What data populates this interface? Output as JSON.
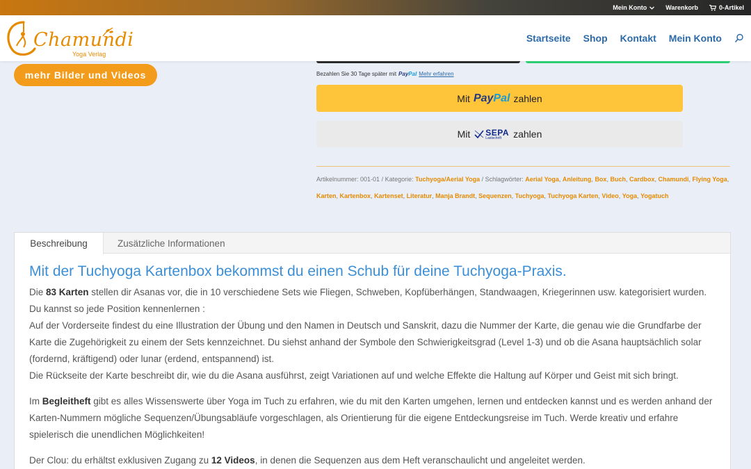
{
  "topbar": {
    "account": "Mein Konto",
    "cart": "Warenkorb",
    "items": "0-Artikel"
  },
  "header": {
    "logo_text": "Chamundi",
    "logo_sub": "Yoga Verlag",
    "nav": [
      "Startseite",
      "Shop",
      "Kontakt",
      "Mein Konto"
    ]
  },
  "media_button": "mehr Bilder und Videos",
  "payment": {
    "pay_later_prefix": "Bezahlen Sie 30 Tage später mit",
    "paypal_pay": "Pay",
    "paypal_pal": "Pal",
    "learn_more": "Mehr erfahren",
    "paypal_prefix": "Mit",
    "paypal_suffix": "zahlen",
    "sepa_prefix": "Mit",
    "sepa_word": "SEPA",
    "sepa_sub": "Lastschrift",
    "sepa_suffix": "zahlen"
  },
  "meta": {
    "sku_label": "Artikelnummer:",
    "sku": "001-01",
    "category_label": "Kategorie:",
    "category": "Tuchyoga/Aerial Yoga",
    "tags_label": "Schlagwörter:",
    "tags": [
      "Aerial Yoga",
      "Anleitung",
      "Box",
      "Buch",
      "Cardbox",
      "Chamundi",
      "Flying Yoga",
      "Karten",
      "Kartenbox",
      "Kartenset",
      "Literatur",
      "Manja Brandt",
      "Sequenzen",
      "Tuchyoga",
      "Tuchyoga Karten",
      "Video",
      "Yoga",
      "Yogatuch"
    ]
  },
  "tabs": [
    "Beschreibung",
    "Zusätzliche Informationen"
  ],
  "description": {
    "heading": "Mit der Tuchyoga Kartenbox bekommst du einen Schub für deine Tuchyoga-Praxis.",
    "p1_a": "Die ",
    "p1_b": "83 Karten",
    "p1_c": " stellen dir Asanas vor, die in 10 verschiedene Sets wie Fliegen, Schweben, Kopfüberhängen, Standwaagen, Kriegerinnen usw.  kategorisiert wurden. Du kannst so jede Position kennenlernen :",
    "p1_d": "Auf der Vorderseite findest du eine Illustration der Übung und den Namen in Deutsch und Sanskrit, dazu die Nummer der Karte, die genau wie die Grundfarbe der Karte die Zugehörigkeit zu einem der Sets kennzeichnet. Du siehst anhand der Symbole den Schwierigkeitsgrad (Level 1-3) und ob die Asana hauptsächlich solar (fordernd, kräftigend) oder lunar (erdend, entspannend) ist.",
    "p1_e": "Die Rückseite der Karte beschreibt dir, wie du die Asana ausführst, zeigt Variationen auf und welche Effekte die Haltung auf Körper und Geist mit sich bringt.",
    "p2_a": "Im ",
    "p2_b": "Begleitheft",
    "p2_c": " gibt es alles Wissenswerte über Yoga im Tuch zu erfahren, wie du mit den Karten umgehen, lernen und entdecken kannst und es werden anhand der Karten-Nummern mögliche Sequenzen/Übungsabläufe vorgeschlagen, als Orientierung für die eigene Entdeckungsreise im Tuch. Werde kreativ und erfahre spielerisch die unendlichen Möglichkeiten!",
    "p3_a": "Der Clou: du erhältst exklusiven Zugang zu ",
    "p3_b": "12 Videos",
    "p3_c": ", in denen die Sequenzen aus dem Heft veranschaulicht und angeleitet werden."
  }
}
